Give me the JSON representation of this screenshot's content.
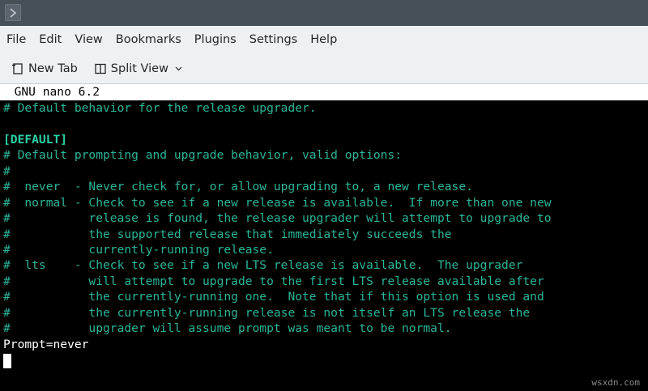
{
  "titlebar": {
    "icon": "terminal-chevron-icon"
  },
  "menubar": {
    "items": [
      "File",
      "Edit",
      "View",
      "Bookmarks",
      "Plugins",
      "Settings",
      "Help"
    ]
  },
  "toolbar": {
    "new_tab_label": "New Tab",
    "new_tab_icon": "new-tab-icon",
    "split_view_label": "Split View",
    "split_view_icon": "split-view-icon"
  },
  "nano": {
    "header": "  GNU nano 6.2",
    "lines": [
      "# Default behavior for the release upgrader.",
      "",
      "[DEFAULT]",
      "# Default prompting and upgrade behavior, valid options:",
      "#",
      "#  never  - Never check for, or allow upgrading to, a new release.",
      "#  normal - Check to see if a new release is available.  If more than one new",
      "#           release is found, the release upgrader will attempt to upgrade to",
      "#           the supported release that immediately succeeds the",
      "#           currently-running release.",
      "#  lts    - Check to see if a new LTS release is available.  The upgrader",
      "#           will attempt to upgrade to the first LTS release available after",
      "#           the currently-running one.  Note that if this option is used and",
      "#           the currently-running release is not itself an LTS release the",
      "#           upgrader will assume prompt was meant to be normal.",
      "Prompt=never"
    ]
  },
  "watermark": "wsxdn.com",
  "colors": {
    "titlebar": "#475057",
    "menubar": "#eff0f1",
    "comment_text": "#2bb598",
    "section_text": "#2bd1a6",
    "plain_text": "#ffffff",
    "terminal_bg": "#000000"
  }
}
